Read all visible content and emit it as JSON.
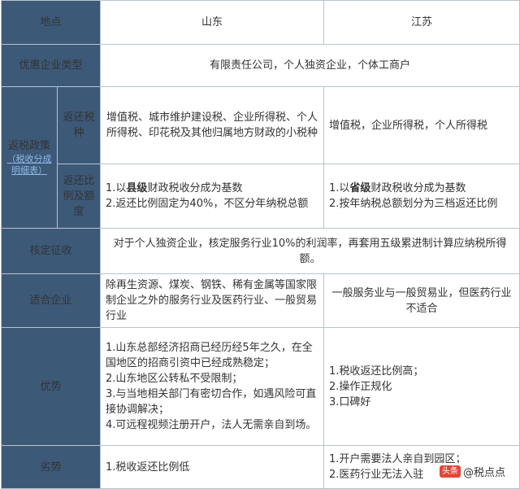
{
  "table": {
    "header": {
      "label": "地点",
      "col_a": "山东",
      "col_b": "江苏"
    },
    "enterprise_type": {
      "label": "优惠企业类型",
      "value": "有限责任公司，个人独资企业，个体工商户"
    },
    "refund_policy": {
      "label": "返税政策",
      "note": "（税收分成明细表）",
      "tax_types": {
        "label": "返还税种",
        "a": "增值税、城市维护建设税、企业所得税、个人所得税、印花税及其他归属地方财政的小税种",
        "b": "增值税，企业所得税，个人所得税"
      },
      "ratio": {
        "label": "返还比例及额度",
        "a_line1_pre": "1.以",
        "a_line1_bold": "县级",
        "a_line1_post": "财政税收分成为基数",
        "a_line2": "2.返还比例固定为40%，不区分年纳税总额",
        "b_line1_pre": "1.以",
        "b_line1_bold": "省级",
        "b_line1_post": "财政税收分成为基数",
        "b_line2": "2.按年纳税总额划分为三档返还比例"
      }
    },
    "verified_collection": {
      "label": "核定征收",
      "value": "对于个人独资企业，核定服务行业10%的利润率，再套用五级累进制计算应纳税所得额。"
    },
    "suitable": {
      "label": "适合企业",
      "a": "除再生资源、煤炭、钢铁、稀有金属等国家限制企业之外的服务行业及医药行业、一般贸易行业",
      "b": "一般服务业与一般贸易业，但医药行业不适合"
    },
    "advantages": {
      "label": "优势",
      "a": [
        "1.山东总部经济招商已经历经5年之久，在全国地区的招商引资中已经成熟稳定；",
        "2.山东地区公转私不受限制；",
        "3.与当地相关部门有密切合作，如遇风险可直接协调解决；",
        "4.可远程视频注册开户，法人无需亲自到场。"
      ],
      "b": [
        "1.税收返还比例高；",
        "2.操作正规化",
        "3.口碑好"
      ]
    },
    "disadvantages": {
      "label": "劣势",
      "a": "1.税收返还比例低",
      "b": [
        "1.开户需要法人亲自到园区；",
        "2.医药行业无法入驻"
      ]
    }
  },
  "watermark": {
    "logo": "头条",
    "text": "@税点点"
  }
}
